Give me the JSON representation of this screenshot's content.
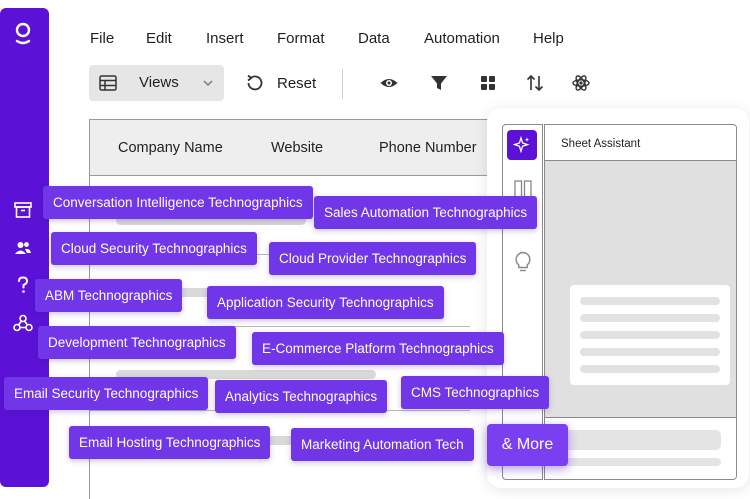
{
  "menu": [
    "File",
    "Edit",
    "Insert",
    "Format",
    "Data",
    "Automation",
    "Help"
  ],
  "toolbar": {
    "views_label": "Views",
    "reset_label": "Reset"
  },
  "grid": {
    "columns": [
      "Company Name",
      "Website",
      "Phone Number"
    ]
  },
  "assistant": {
    "title": "Sheet Assistant"
  },
  "chips": [
    "Conversation Intelligence Technographics",
    "Sales Automation Technographics",
    "Cloud Security Technographics",
    "Cloud Provider Technographics",
    "ABM Technographics",
    "Application Security Technographics",
    "Development Technographics",
    "E-Commerce Platform Technographics",
    "Email Security Technographics",
    "Analytics Technographics",
    "CMS Technographics",
    "Email Hosting Technographics",
    "Marketing Automation Tech"
  ],
  "more_label": "& More",
  "colors": {
    "rail": "#5b12d6",
    "chip": "#7036e8",
    "accent": "#5b12d6"
  },
  "icons": [
    "logo-icon",
    "archive-icon",
    "users-icon",
    "help-icon",
    "webhook-icon",
    "table-icon",
    "chevron-down-icon",
    "reset-icon",
    "eye-icon",
    "filter-icon",
    "grid-icon",
    "sort-icon",
    "atom-icon",
    "sparkle-icon",
    "columns-icon",
    "lightbulb-icon"
  ]
}
